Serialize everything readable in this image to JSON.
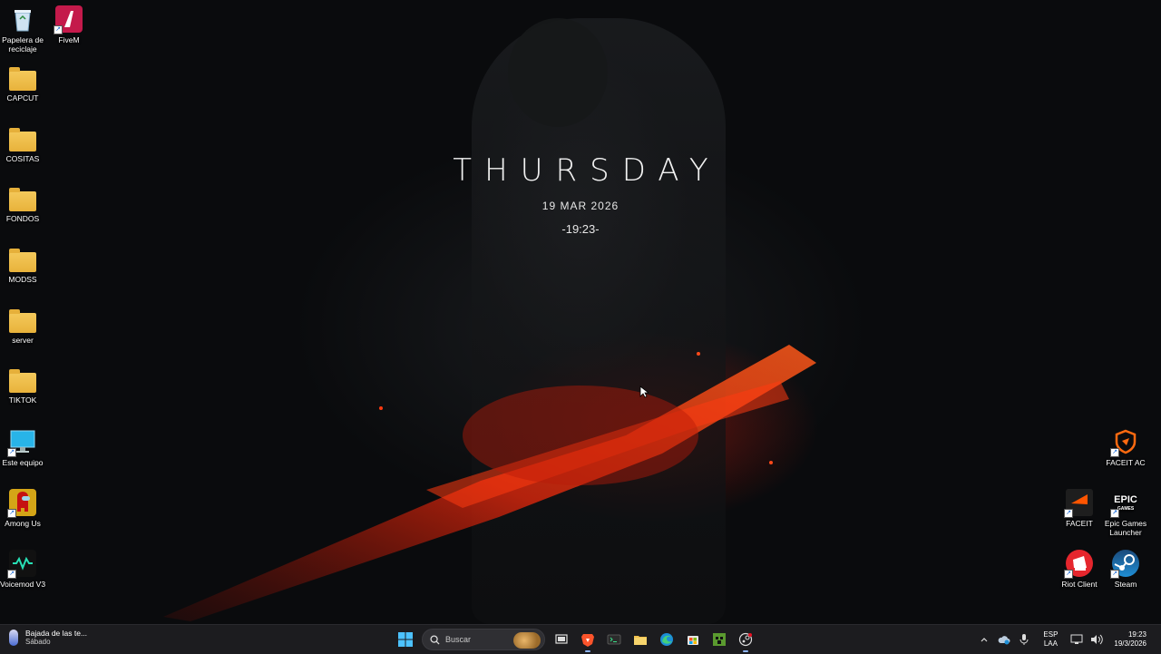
{
  "clock": {
    "day": "THURSDAY",
    "date": "19 MAR 2026",
    "time": "-19:23-"
  },
  "desktop_icons": {
    "recycle_bin": {
      "label": "Papelera de reciclaje",
      "icon": "recycle-bin-icon"
    },
    "fivem": {
      "label": "FiveM",
      "icon": "fivem-icon"
    },
    "capcut": {
      "label": "CAPCUT",
      "icon": "folder-icon"
    },
    "cositas": {
      "label": "COSITAS",
      "icon": "folder-icon"
    },
    "fondos": {
      "label": "FONDOS",
      "icon": "folder-icon"
    },
    "modss": {
      "label": "MODSS",
      "icon": "folder-icon"
    },
    "server": {
      "label": "server",
      "icon": "folder-icon"
    },
    "tiktok": {
      "label": "TIKTOK",
      "icon": "folder-icon"
    },
    "este_equipo": {
      "label": "Este equipo",
      "icon": "computer-icon"
    },
    "among_us": {
      "label": "Among Us",
      "icon": "among-us-icon"
    },
    "voicemod": {
      "label": "Voicemod V3",
      "icon": "voicemod-icon"
    },
    "faceit_ac": {
      "label": "FACEIT AC",
      "icon": "faceit-ac-icon"
    },
    "faceit": {
      "label": "FACEIT",
      "icon": "faceit-icon"
    },
    "epic": {
      "label": "Epic Games Launcher",
      "icon": "epic-games-icon",
      "logo_text": "EPIC GAMES"
    },
    "riot": {
      "label": "Riot Client",
      "icon": "riot-icon"
    },
    "steam": {
      "label": "Steam",
      "icon": "steam-icon"
    }
  },
  "taskbar": {
    "weather": {
      "title": "Bajada de las te...",
      "subtitle": "Sábado"
    },
    "search_placeholder": "Buscar",
    "apps": [
      "start-icon",
      "search-icon",
      "task-view-icon",
      "brave-icon",
      "terminal-icon",
      "file-explorer-icon",
      "edge-icon",
      "store-icon",
      "minecraft-icon",
      "steam-tray-icon"
    ],
    "tray": {
      "lang_line1": "ESP",
      "lang_line2": "LAA",
      "time": "19:23",
      "date": "19/3/2026"
    }
  },
  "colors": {
    "accent": "#e02a10",
    "taskbar_bg": "#1c1c1f",
    "folder": "#f4c95b"
  }
}
